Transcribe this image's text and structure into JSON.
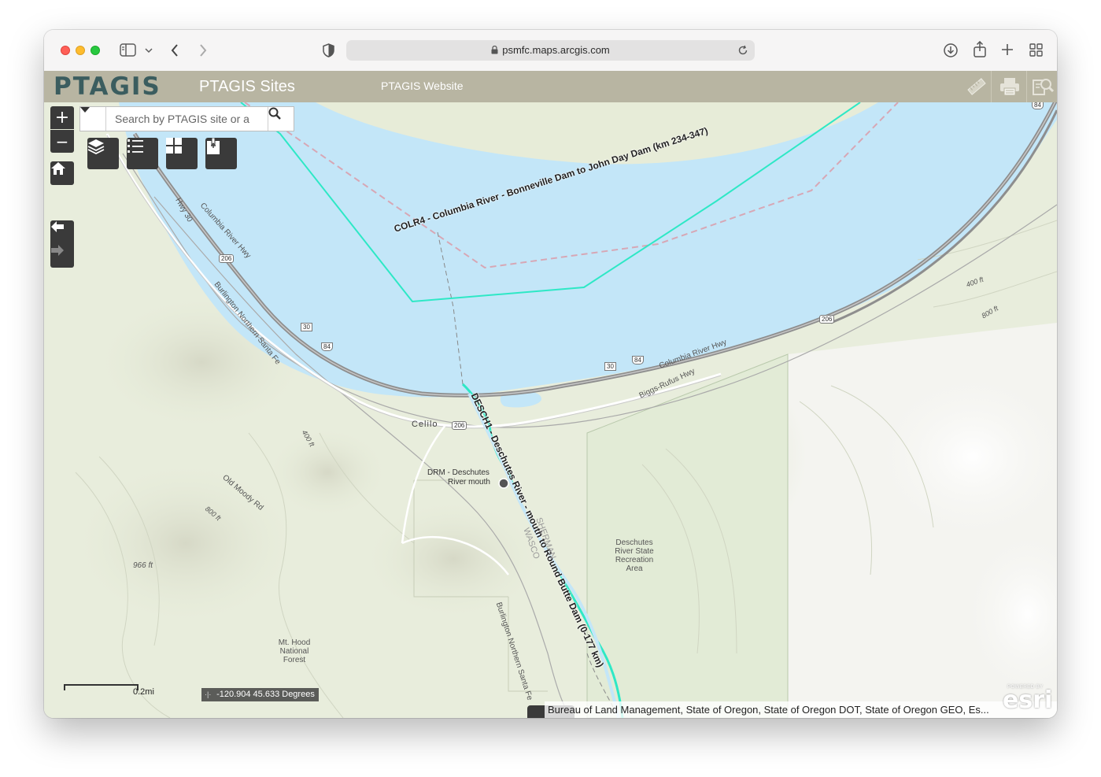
{
  "browser": {
    "url": "psmfc.maps.arcgis.com",
    "icons": [
      "sidebar-icon",
      "chevron-down-icon",
      "back-icon",
      "forward-icon",
      "shield-icon",
      "lock-icon",
      "reload-icon",
      "download-icon",
      "share-icon",
      "new-tab-icon",
      "tab-overview-icon"
    ]
  },
  "app": {
    "logo_text": "PTAGIS",
    "title": "PTAGIS Sites",
    "website_link": "PTAGIS Website",
    "colors": {
      "header_bg": "#b8b5a2",
      "logo": "#3b5d5f",
      "water": "#c3e6f8",
      "site_line": "#2ee8c6"
    },
    "header_tools": [
      "measure-icon",
      "print-icon",
      "query-icon"
    ]
  },
  "map_controls": {
    "zoom_in": "+",
    "zoom_out": "−",
    "search_placeholder": "Search by PTAGIS site or a",
    "widgets": [
      "layers-icon",
      "legend-icon",
      "basemap-gallery-icon",
      "bookmarks-icon"
    ],
    "nav": [
      "home-icon",
      "previous-extent-icon",
      "next-extent-icon"
    ]
  },
  "map_labels": {
    "colr4": "COLR4 - Columbia River - Bonneville Dam to John Day Dam (km 234-347)",
    "desch1": "DESCH1 - Deschutes River - mouth to Round Butte Dam (0-177 km)",
    "drm_line1": "DRM - Deschutes",
    "drm_line2": "River mouth",
    "celilo": "Celilo",
    "columbia_hwy_left": "Columbia River Hwy",
    "columbia_hwy_right": "Columbia River Hwy",
    "hwy30": "Hwy 30",
    "biggs_rufus": "Biggs-Rufus Hwy",
    "bnsf_upper": "Burlington Northern Santa Fe",
    "bnsf_lower": "Burlington Northern Santa Fe",
    "old_moody": "Old Moody Rd",
    "wasco": "WASCO",
    "sherman": "SHERMAN",
    "deschutes_park": [
      "Deschutes",
      "River State",
      "Recreation",
      "Area"
    ],
    "mt_hood": [
      "Mt. Hood",
      "National",
      "Forest"
    ],
    "elev_966": "966 ft",
    "elev_400_a": "400 ft",
    "elev_800_a": "800 ft",
    "elev_400_b": "400 ft",
    "elev_800_b": "800 ft",
    "shields": [
      "206",
      "30",
      "84",
      "206",
      "30",
      "84",
      "206",
      "84"
    ]
  },
  "footer": {
    "scale": "0.2mi",
    "coordinates": "-120.904 45.633 Degrees",
    "attribution": "Bureau of Land Management, State of Oregon, State of Oregon DOT, State of Oregon GEO, Es...",
    "esri_powered": "POWERED BY",
    "esri": "esri"
  }
}
